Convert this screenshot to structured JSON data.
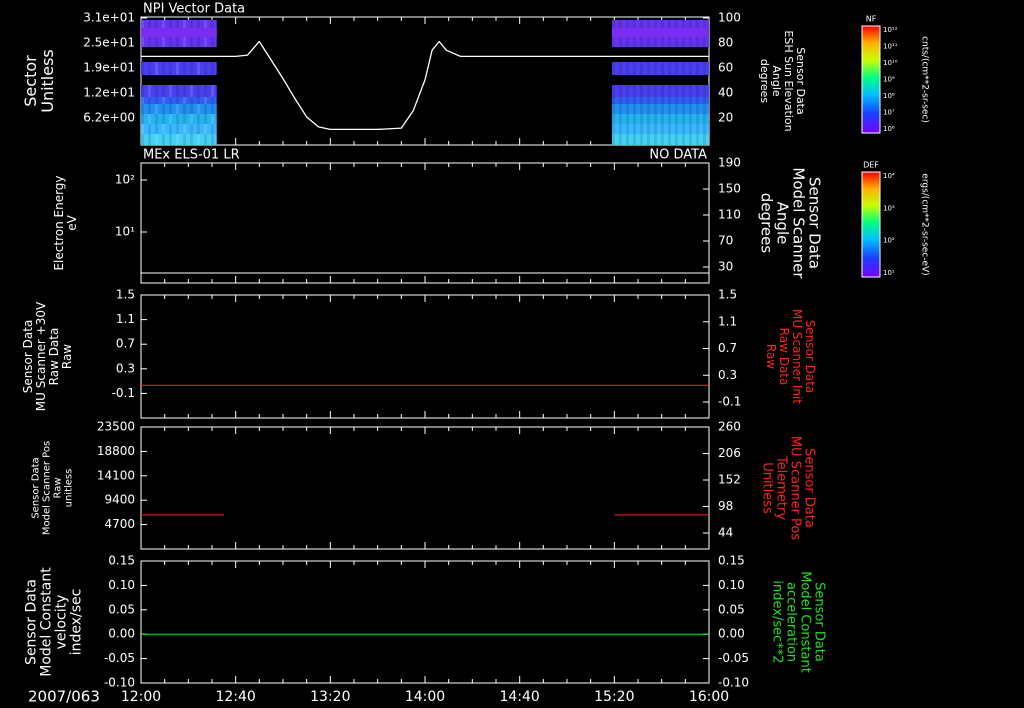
{
  "chart_data": [
    {
      "type": "heatmap",
      "title": "NPI Vector Data",
      "ylabel": [
        "Sector",
        "Unitless"
      ],
      "yticks": [
        "3.1e+01",
        "2.5e+01",
        "1.9e+01",
        "1.2e+01",
        "6.2e+00"
      ],
      "right_label": [
        "Sensor Data",
        "ESH Sun Elevation",
        "Angle",
        "degrees"
      ],
      "right_ticks": [
        "100",
        "80",
        "60",
        "40",
        "20"
      ],
      "right_ylim": [
        0,
        100
      ],
      "line_series": {
        "x": [
          "12:00",
          "12:30",
          "12:40",
          "12:45",
          "12:50",
          "12:55",
          "13:00",
          "13:05",
          "13:10",
          "13:15",
          "13:20",
          "13:30",
          "13:40",
          "13:50",
          "13:55",
          "14:00",
          "14:03",
          "14:06",
          "14:09",
          "14:15",
          "14:20",
          "14:40",
          "15:00",
          "15:20",
          "16:00"
        ],
        "values": [
          69,
          69,
          69,
          70,
          81,
          66,
          51,
          35,
          20,
          12,
          10,
          10,
          10,
          11,
          25,
          50,
          74,
          81,
          74,
          69,
          69,
          69,
          69,
          69,
          69
        ]
      },
      "colorbar": {
        "label": "NF",
        "units": "cnts/(cm**2-sr-sec)",
        "ticks": [
          "10¹²",
          "10¹¹",
          "10¹⁰",
          "10⁹",
          "10⁸",
          "10⁷",
          "10⁶"
        ]
      },
      "data_blocks": [
        [
          "12:00",
          "12:32"
        ],
        [
          "15:19",
          "16:00"
        ]
      ]
    },
    {
      "type": "line",
      "title": "MEx ELS-01 LR",
      "status": "NO DATA",
      "ylabel": [
        "Electron Energy",
        "eV"
      ],
      "yticks": [
        "10²",
        "10¹"
      ],
      "right_label": [
        "Sensor Data",
        "Model Scanner",
        "Angle",
        "degrees"
      ],
      "right_ticks": [
        "190",
        "150",
        "110",
        "70",
        "30"
      ],
      "right_ylim": [
        0,
        190
      ],
      "line_series": {
        "x": [
          "12:00",
          "16:00"
        ],
        "values": [
          10,
          10
        ]
      },
      "colorbar": {
        "label": "DEF",
        "units": "ergs/(cm**2-sr-sec-eV)",
        "ticks": [
          "10⁴",
          "10³",
          "10²",
          "10¹"
        ]
      }
    },
    {
      "type": "line",
      "ylabel": [
        "Sensor Data",
        "MU Scanner +30V",
        "Raw Data",
        "Raw"
      ],
      "yticks": [
        "1.5",
        "1.1",
        "0.7",
        "0.3",
        "-0.1"
      ],
      "ylim": [
        -0.5,
        1.5
      ],
      "right_label": [
        "Sensor Data",
        "MU Scanner Init",
        "Raw Data",
        "Raw"
      ],
      "right_ticks": [
        "1.5",
        "1.1",
        "0.7",
        "0.3",
        "-0.1"
      ],
      "series_color": "#ff2020",
      "line_series": {
        "x": [
          "12:00",
          "16:00"
        ],
        "values": [
          0.0,
          0.0
        ]
      }
    },
    {
      "type": "line",
      "ylabel": [
        "Sensor Data",
        "Model Scanner Pos",
        "Raw",
        "unitless"
      ],
      "yticks": [
        "23500",
        "18800",
        "14100",
        "9400",
        "4700"
      ],
      "ylim": [
        0,
        23500
      ],
      "right_label": [
        "Sensor Data",
        "MU Scanner Pos",
        "Telemetry",
        "Unitless"
      ],
      "right_ticks": [
        "260",
        "206",
        "152",
        "98",
        "44"
      ],
      "series_color": "#ff2020",
      "line_segments": [
        {
          "x": [
            "12:00",
            "12:35"
          ],
          "values": [
            7150,
            7150
          ]
        },
        {
          "x": [
            "15:20",
            "16:00"
          ],
          "values": [
            7150,
            7150
          ]
        }
      ]
    },
    {
      "type": "line",
      "ylabel": [
        "Sensor Data",
        "Model Constant",
        "velocity",
        "index/sec"
      ],
      "yticks": [
        "0.15",
        "0.10",
        "0.05",
        "0.00",
        "-0.05",
        "-0.10"
      ],
      "ylim": [
        -0.1,
        0.15
      ],
      "right_label": [
        "Sensor Data",
        "Model Constant",
        "acceleration",
        "index/sec**2"
      ],
      "right_ticks": [
        "0.15",
        "0.10",
        "0.05",
        "0.00",
        "-0.05",
        "-0.10"
      ],
      "series_color": "#20e020",
      "line_series": {
        "x": [
          "12:00",
          "16:00"
        ],
        "values": [
          0.0,
          0.0
        ]
      }
    }
  ],
  "x_axis": {
    "date_label": "2007/063",
    "ticks": [
      "12:00",
      "12:40",
      "13:20",
      "14:00",
      "14:40",
      "15:20",
      "16:00"
    ],
    "range": [
      "12:00",
      "16:00"
    ]
  },
  "colors": {
    "right_label_panel3": "#ff2020",
    "right_label_panel4": "#ff2020",
    "right_label_panel5": "#20e020"
  }
}
